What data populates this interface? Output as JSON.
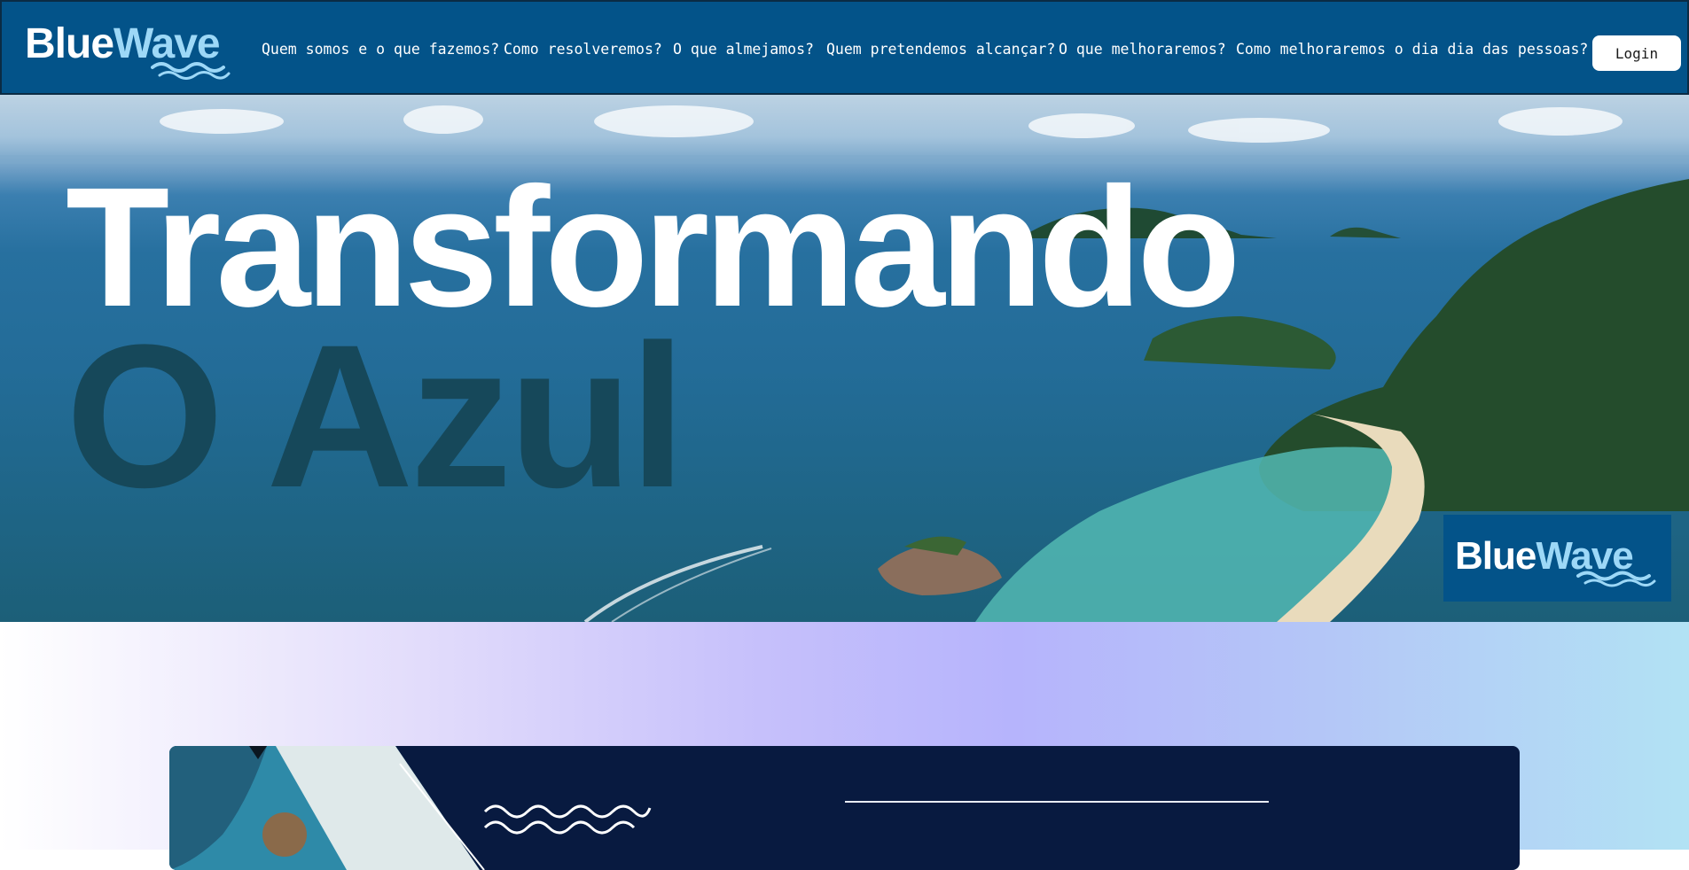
{
  "brand": {
    "name_part1": "Blue",
    "name_part2": "Wave",
    "primary_color": "#035389",
    "accent_color": "#9dd8f7"
  },
  "nav": {
    "links": [
      "Quem somos e o que fazemos?",
      "Como resolveremos?",
      "O que almejamos?",
      "Quem pretendemos alcançar?",
      "O que melhoraremos?",
      "Como melhoraremos o dia dia das pessoas?"
    ],
    "login_label": "Login"
  },
  "hero": {
    "title": "Transformando",
    "subtitle": "O Azul",
    "title_color": "#ffffff",
    "subtitle_color": "#16485a"
  },
  "section": {
    "card_color": "#081a40"
  }
}
